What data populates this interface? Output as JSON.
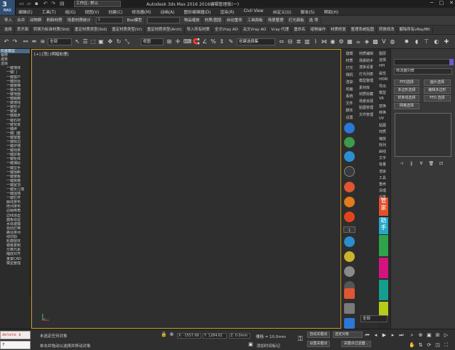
{
  "app": {
    "logo": "MAX",
    "workspace": "工作区: 默认",
    "title": "Autodesk 3ds Max 2016    2016编辑管理版(一)"
  },
  "menu": [
    "编辑(E)",
    "工具(T)",
    "组(G)",
    "视图(V)",
    "创建(C)",
    "修改器(M)",
    "动画(A)",
    "图形编辑器(D)",
    "渲染(R)",
    "Civil View",
    "自定义(U)",
    "脚本(S)",
    "帮助(H)"
  ],
  "toolbar1": [
    "导入",
    "合并",
    "动物群",
    "刷新材质",
    "场景材质统计",
    "Box模型",
    "",
    "物品缩放",
    "材质/图层",
    "自动重命",
    "工具面板",
    "场景整理",
    "灯光面板",
    "选 项"
  ],
  "toolbar1_dropdowns": [
    "1",
    ""
  ],
  "toolbar2": [
    "选择",
    "丢开面",
    "转换为标准材质(Std)",
    "重定材质类型(Std)",
    "重定材质类型(Vr)",
    "重定材质类型(Arch)",
    "导入所有材质",
    "全文Vray AO",
    "关文Vray AO",
    "Vray 代理",
    "重命名",
    "组物操作",
    "材质修复",
    "整理系统贴图",
    "转换修改",
    "解除所有vRayMtl"
  ],
  "main_toolbar": {
    "filter": "全部",
    "ref_coord": "视图",
    "named_set": "创建选择集",
    "snap_count": "3"
  },
  "left_panel": [
    {
      "label": "石墨模型",
      "hl": true,
      "indent": false
    },
    {
      "label": "装修",
      "hl": false,
      "indent": false
    },
    {
      "label": "建筑",
      "hl": false,
      "indent": false
    },
    {
      "label": "选择",
      "hl": false,
      "indent": false
    },
    {
      "label": "一键墙体",
      "hl": false,
      "indent": true
    },
    {
      "label": "一键门",
      "hl": false,
      "indent": true
    },
    {
      "label": "一键窗户",
      "hl": false,
      "indent": true
    },
    {
      "label": "一键阳台",
      "hl": false,
      "indent": true
    },
    {
      "label": "一键楼梯",
      "hl": false,
      "indent": true
    },
    {
      "label": "一键吊顶",
      "hl": false,
      "indent": true
    },
    {
      "label": "一键地面",
      "hl": false,
      "indent": true
    },
    {
      "label": "一键踢脚",
      "hl": false,
      "indent": true
    },
    {
      "label": "一键墙线",
      "hl": false,
      "indent": true
    },
    {
      "label": "一键柱子",
      "hl": false,
      "indent": true
    },
    {
      "label": "一键梁",
      "hl": false,
      "indent": true
    },
    {
      "label": "一键踏步",
      "hl": false,
      "indent": true
    },
    {
      "label": "一键石材",
      "hl": false,
      "indent": true
    },
    {
      "label": "一键背景",
      "hl": false,
      "indent": true
    },
    {
      "label": "一键砖",
      "hl": false,
      "indent": true
    },
    {
      "label": "一键门套",
      "hl": false,
      "indent": true
    },
    {
      "label": "一键窗套",
      "hl": false,
      "indent": true
    },
    {
      "label": "一键收边",
      "hl": false,
      "indent": true
    },
    {
      "label": "一键护墙",
      "hl": false,
      "indent": true
    },
    {
      "label": "一键线条",
      "hl": false,
      "indent": true
    },
    {
      "label": "一键层板",
      "hl": false,
      "indent": true
    },
    {
      "label": "一键柜体",
      "hl": false,
      "indent": true
    },
    {
      "label": "一键抽屉",
      "hl": false,
      "indent": true
    },
    {
      "label": "一键拉手",
      "hl": false,
      "indent": true
    },
    {
      "label": "一键隔断",
      "hl": false,
      "indent": true
    },
    {
      "label": "一键楼板",
      "hl": false,
      "indent": true
    },
    {
      "label": "一键挑檐",
      "hl": false,
      "indent": true
    },
    {
      "label": "一键屋顶",
      "hl": false,
      "indent": true
    },
    {
      "label": "一键女儿墙",
      "hl": false,
      "indent": true
    },
    {
      "label": "一键围墙",
      "hl": false,
      "indent": true
    },
    {
      "label": "一键栏杆",
      "hl": false,
      "indent": true
    },
    {
      "label": "曲线排布",
      "hl": false,
      "indent": true
    },
    {
      "label": "阵列排布",
      "hl": false,
      "indent": true
    },
    {
      "label": "边缘倒角",
      "hl": false,
      "indent": true
    },
    {
      "label": "边线造型",
      "hl": false,
      "indent": true
    },
    {
      "label": "面板造型",
      "hl": false,
      "indent": true
    },
    {
      "label": "水体建模",
      "hl": false,
      "indent": true
    },
    {
      "label": "自动灯带",
      "hl": false,
      "indent": true
    },
    {
      "label": "路径排列",
      "hl": false,
      "indent": true
    },
    {
      "label": "线切割",
      "hl": false,
      "indent": true
    },
    {
      "label": "轮廓放样",
      "hl": false,
      "indent": true
    },
    {
      "label": "镜像复制",
      "hl": false,
      "indent": true
    },
    {
      "label": "分离元素",
      "hl": false,
      "indent": true
    },
    {
      "label": "缩放对齐",
      "hl": false,
      "indent": true
    },
    {
      "label": "重置CAD",
      "hl": false,
      "indent": true
    },
    {
      "label": "模型整理",
      "hl": false,
      "indent": true
    }
  ],
  "viewport_label": "[+] [顶] [明暗处理]",
  "col1_tabs": [
    "建模",
    "材质",
    "灯光",
    "相机",
    "渲染",
    "动画",
    "系统",
    "文件",
    "脚本",
    "设置"
  ],
  "col1_count": "1",
  "col2": [
    "材质编辑",
    "场景助手",
    "渲染设置",
    "灯光列表",
    "模型整理",
    "素材库",
    "材质收藏",
    "场景资源",
    "贴图管理",
    "文件管理"
  ],
  "col2b": [
    "图层",
    "选择",
    "HPI",
    "属性",
    "HDRI",
    "导出",
    "模型",
    "VR",
    "替换",
    "转换",
    "UV",
    "贴图",
    "材质",
    "缩放",
    "阵列",
    "曲线",
    "文字",
    "批量",
    "渲染",
    "工具",
    "重命",
    "清理",
    "设置"
  ],
  "color_bars": [
    {
      "label": "管家",
      "color": "#e4502b"
    },
    {
      "label": "助手",
      "color": "#25a8c9"
    },
    {
      "label": "",
      "color": "#2ea44a"
    },
    {
      "label": "",
      "color": "#d3147f"
    },
    {
      "label": "",
      "color": "#159e8c"
    },
    {
      "label": "",
      "color": "#b7cc1a"
    }
  ],
  "command_panel": {
    "modifier_list": "修改器列表",
    "buttons": [
      "FFD选择",
      "面片选择",
      "多边形选择",
      "编辑多边形",
      "样条线选择",
      "FFD 选择",
      "网格选择"
    ],
    "bottom_dropdown": "全部"
  },
  "status": {
    "script_input": "delete $",
    "script_output": "7",
    "prompt1": "未选定任何对象",
    "prompt2": "单击并拖动以选择并移动对象",
    "x": "X: -1557.66",
    "y": "Y: 1284.61",
    "z": "Z: 0.0mm",
    "grid": "栅格 = 10.0mm",
    "auto_key": "自动关键点",
    "set_key": "设置关键点",
    "selected": "选定对象",
    "key_filter": "关键点过滤器...",
    "add_time_tag": "添加时间标记"
  }
}
